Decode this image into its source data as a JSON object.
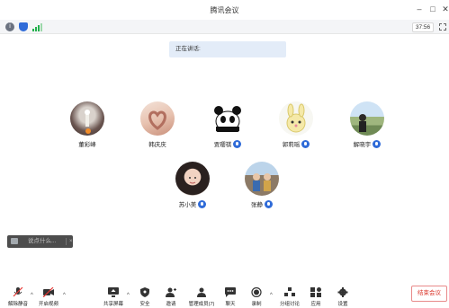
{
  "window": {
    "title": "腾讯会议",
    "minimize": "–",
    "maximize": "□",
    "close": "✕"
  },
  "infobar": {
    "timer": "37:56"
  },
  "speaking_banner": "正在讲话:",
  "participants": [
    {
      "name": "董彩峰",
      "mic": false
    },
    {
      "name": "韩庆庆",
      "mic": false
    },
    {
      "name": "贾璎祺",
      "mic": true
    },
    {
      "name": "郭莉瑶",
      "mic": true
    },
    {
      "name": "解晓宇",
      "mic": true
    },
    {
      "name": "苏小美",
      "mic": true
    },
    {
      "name": "张静",
      "mic": true
    }
  ],
  "chat": {
    "placeholder": "说点什么...",
    "close": "×"
  },
  "toolbar": {
    "unmute": "解除静音",
    "video": "开启视频",
    "share": "共享屏幕",
    "security": "安全",
    "invite": "邀请",
    "members": "管理成员(7)",
    "chat": "聊天",
    "record": "录制",
    "breakout": "分组讨论",
    "apps": "应用",
    "settings": "设置",
    "end": "结束会议",
    "caret": "^"
  },
  "colors": {
    "accent": "#2f6bd8",
    "danger": "#d93025",
    "signal": "#22b14c"
  }
}
